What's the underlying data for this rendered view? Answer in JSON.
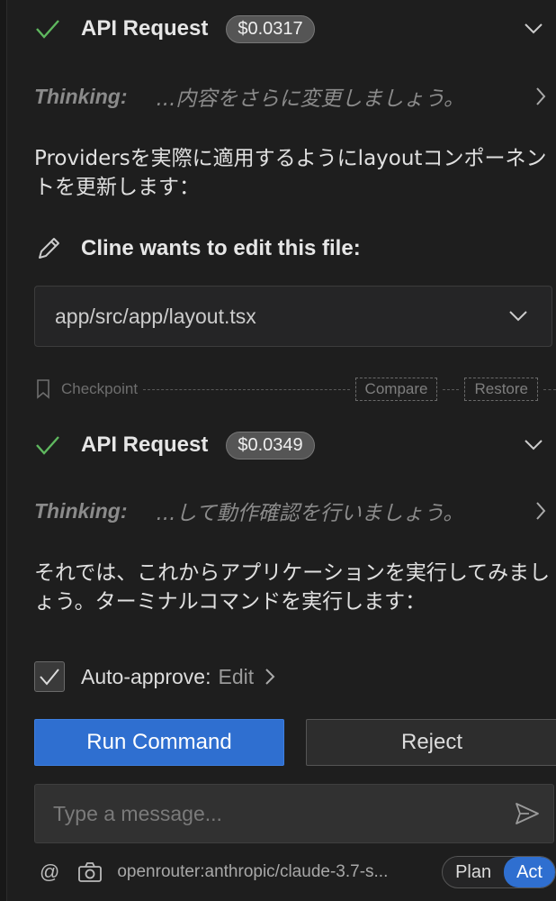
{
  "blocks": [
    {
      "api_title": "API Request",
      "cost": "$0.0317",
      "thinking_label": "Thinking:",
      "thinking_text": "...内容をさらに変更しましょう。",
      "paragraph": "Providersを実際に適用するようにlayoutコンポーネントを更新します："
    },
    {
      "api_title": "API Request",
      "cost": "$0.0349",
      "thinking_label": "Thinking:",
      "thinking_text": "...して動作確認を行いましょう。",
      "paragraph": "それでは、これからアプリケーションを実行してみましょう。ターミナルコマンドを実行します："
    }
  ],
  "edit": {
    "title": "Cline wants to edit this file:",
    "file_path": "app/src/app/layout.tsx"
  },
  "checkpoint": {
    "label": "Checkpoint",
    "compare": "Compare",
    "restore": "Restore"
  },
  "auto_approve": {
    "label": "Auto-approve:",
    "value": "Edit",
    "checked": true
  },
  "actions": {
    "primary": "Run Command",
    "secondary": "Reject"
  },
  "composer": {
    "placeholder": "Type a message...",
    "at_symbol": "@",
    "model": "openrouter:anthropic/claude-3.7-s...",
    "mode_plan": "Plan",
    "mode_act": "Act",
    "active_mode": "Act"
  },
  "colors": {
    "accent": "#2f6fd0",
    "success": "#4caf50",
    "background": "#1e1e1e"
  }
}
